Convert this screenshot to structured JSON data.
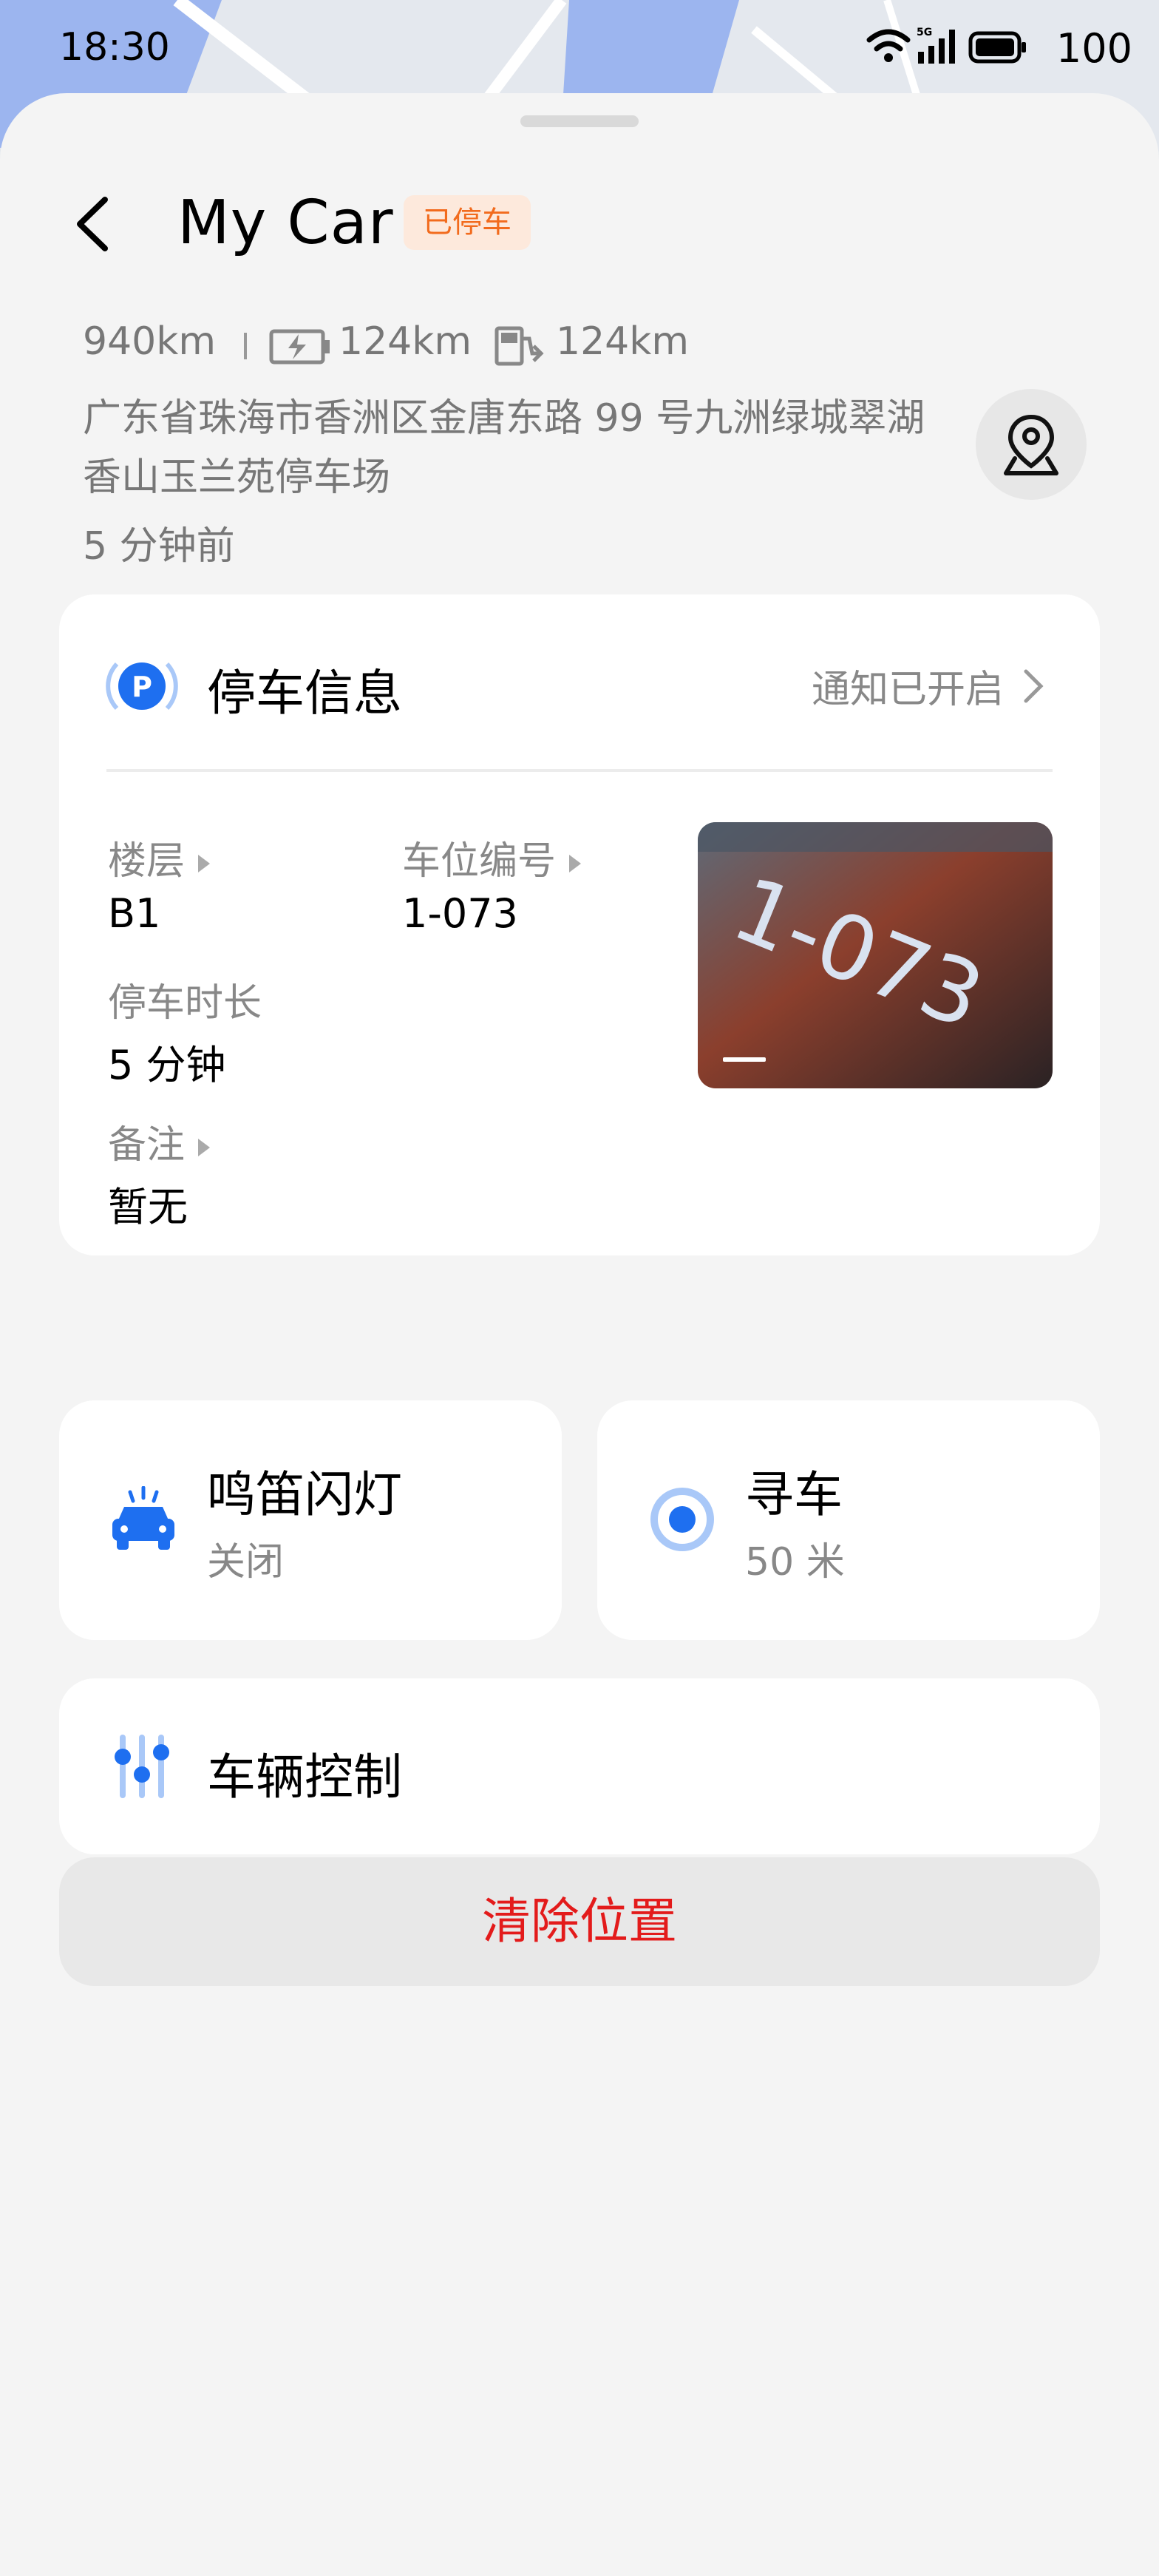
{
  "status_bar": {
    "time": "18:30",
    "battery": "100",
    "network": "5G"
  },
  "header": {
    "title": "My Car",
    "badge": "已停车"
  },
  "car_info": {
    "total_range": "940km",
    "electric_range": "124km",
    "fuel_range": "124km",
    "address": "广东省珠海市香洲区金唐东路 99 号九洲绿城翠湖香山玉兰苑停车场",
    "time_ago": "5 分钟前"
  },
  "parking": {
    "title": "停车信息",
    "notice": "通知已开启",
    "floor_label": "楼层",
    "floor_value": "B1",
    "spot_label": "车位编号",
    "spot_value": "1-073",
    "duration_label": "停车时长",
    "duration_value": "5 分钟",
    "note_label": "备注",
    "note_value": "暂无",
    "photo_text": "1-073"
  },
  "actions": {
    "horn": {
      "title": "鸣笛闪灯",
      "status": "关闭"
    },
    "find": {
      "title": "寻车",
      "distance": "50 米"
    },
    "control": {
      "title": "车辆控制"
    }
  },
  "clear_button": "清除位置",
  "colors": {
    "accent": "#1e6ff0",
    "badge_text": "#f26b1d",
    "danger": "#e31b1b"
  }
}
